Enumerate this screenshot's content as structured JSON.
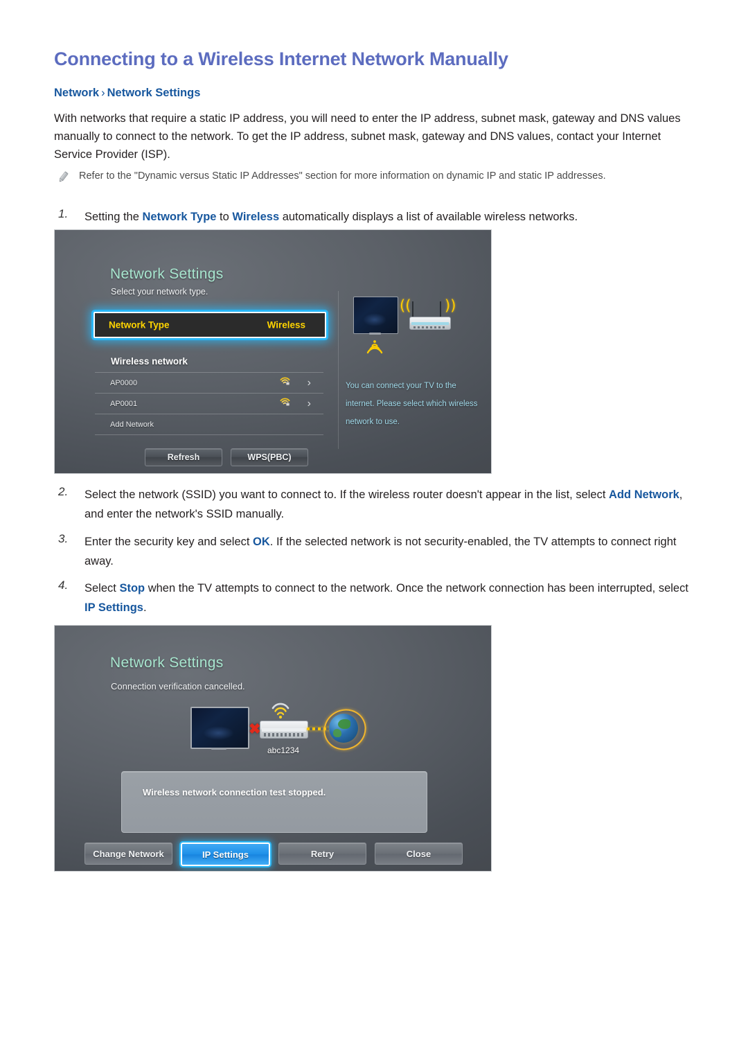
{
  "document": {
    "title": "Connecting to a Wireless Internet Network Manually",
    "breadcrumb": {
      "root": "Network",
      "separator": "›",
      "leaf": "Network Settings"
    },
    "intro": "With networks that require a static IP address, you will need to enter the IP address, subnet mask, gateway and DNS values manually to connect to the network. To get the IP address, subnet mask, gateway and DNS values, contact your Internet Service Provider (ISP).",
    "note": {
      "icon": "pencil-icon",
      "text": "Refer to the \"Dynamic versus Static IP Addresses\" section for more information on dynamic IP and static IP addresses."
    },
    "steps": [
      {
        "number": "1.",
        "parts": [
          {
            "text": "Setting the ",
            "kw": false
          },
          {
            "text": "Network Type",
            "kw": true
          },
          {
            "text": " to ",
            "kw": false
          },
          {
            "text": "Wireless",
            "kw": true
          },
          {
            "text": " automatically displays a list of available wireless networks.",
            "kw": false
          }
        ]
      },
      {
        "number": "2.",
        "parts": [
          {
            "text": "Select the network (SSID) you want to connect to. If the wireless router doesn't appear in the list, select ",
            "kw": false
          },
          {
            "text": "Add Network",
            "kw": true
          },
          {
            "text": ", and enter the network's SSID manually.",
            "kw": false
          }
        ]
      },
      {
        "number": "3.",
        "parts": [
          {
            "text": "Enter the security key and select ",
            "kw": false
          },
          {
            "text": "OK",
            "kw": true
          },
          {
            "text": ". If the selected network is not security-enabled, the TV attempts to connect right away.",
            "kw": false
          }
        ]
      },
      {
        "number": "4.",
        "parts": [
          {
            "text": "Select ",
            "kw": false
          },
          {
            "text": "Stop",
            "kw": true
          },
          {
            "text": " when the TV attempts to connect to the network. Once the network connection has been interrupted, select ",
            "kw": false
          },
          {
            "text": "IP Settings",
            "kw": true
          },
          {
            "text": ".",
            "kw": false
          }
        ]
      }
    ]
  },
  "screenshot_one": {
    "title": "Network Settings",
    "subtitle": "Select your network type.",
    "selected_row": {
      "label": "Network Type",
      "value": "Wireless"
    },
    "list_header": "Wireless network",
    "networks": [
      {
        "name": "AP0000",
        "icon": "wifi-lock-icon",
        "chevron": "›"
      },
      {
        "name": "AP0001",
        "icon": "wifi-lock-icon",
        "chevron": "›"
      },
      {
        "name": "Add Network",
        "icon": "",
        "chevron": ""
      }
    ],
    "buttons": [
      {
        "label": "Refresh"
      },
      {
        "label": "WPS(PBC)"
      }
    ],
    "side_text": "You can connect your TV to the internet. Please select which wireless network to use.",
    "diagram": {
      "tv": "tv-icon",
      "router": "router-icon",
      "signal": "wifi-signal-icon"
    }
  },
  "screenshot_two": {
    "title": "Network Settings",
    "subtitle": "Connection verification cancelled.",
    "ssid": "abc1234",
    "message": "Wireless network connection test stopped.",
    "diagram": {
      "tv": "tv-icon",
      "router": "router-icon",
      "globe": "globe-icon",
      "error": "x-mark-icon"
    },
    "buttons": [
      {
        "label": "Change Network",
        "primary": false
      },
      {
        "label": "IP Settings",
        "primary": true
      },
      {
        "label": "Retry",
        "primary": false
      },
      {
        "label": "Close",
        "primary": false
      }
    ]
  },
  "colors": {
    "title": "#5c6cbf",
    "breadcrumb": "#17579e",
    "keyword": "#17579e",
    "body": "#231f20",
    "note": "#4a4a4a",
    "tv_heading": "#a8e6cf",
    "tv_highlight": "#ffd400",
    "tv_focus_glow": "#29b6f6",
    "tv_side_text": "#9fd8e8",
    "signal_yellow": "#ffcc00",
    "error_red": "#e02b1c"
  }
}
